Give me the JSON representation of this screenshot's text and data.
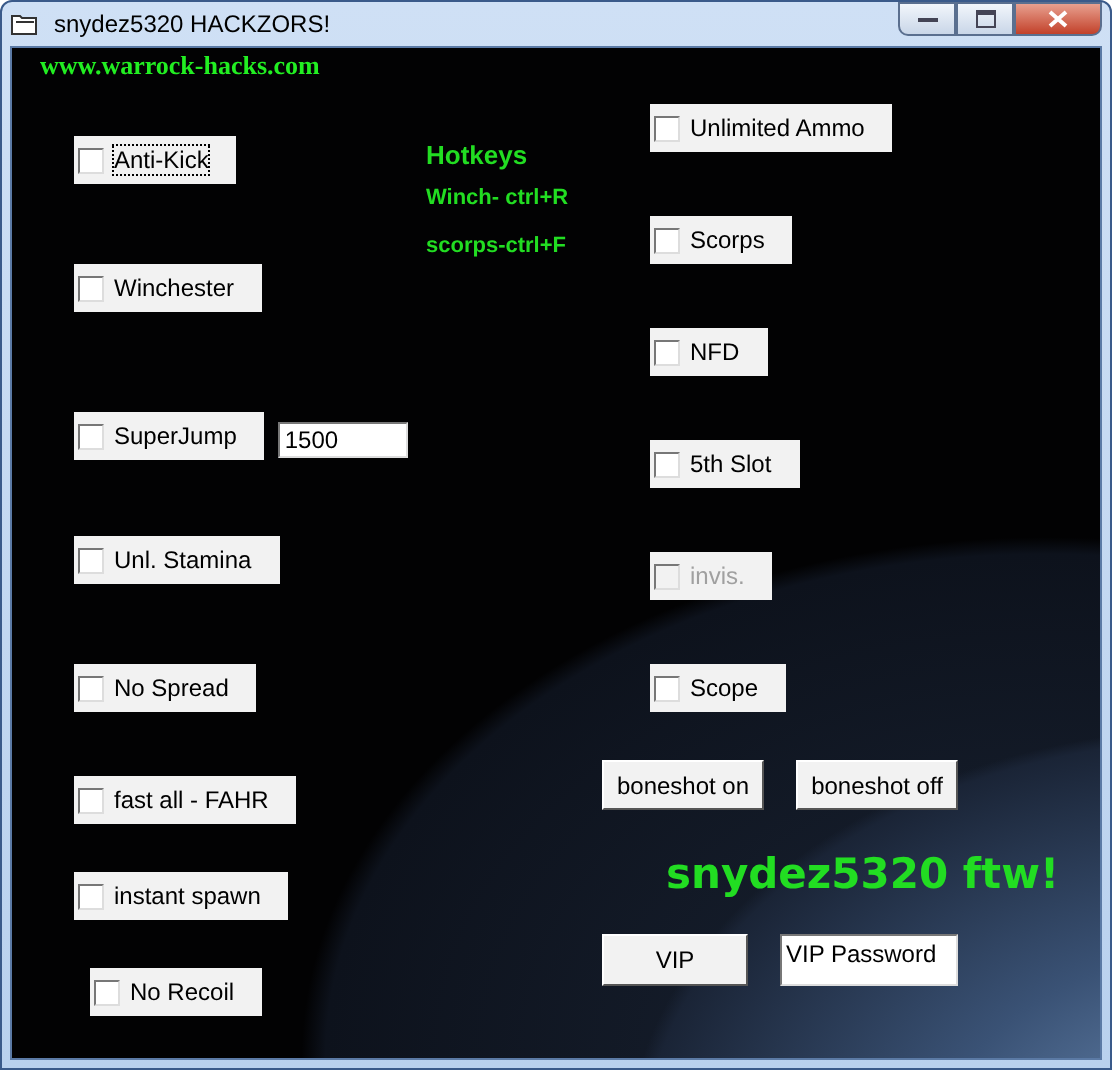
{
  "window": {
    "title": "snydez5320 HACKZORS!"
  },
  "site_link": "www.warrock-hacks.com",
  "hotkeys": {
    "title": "Hotkeys",
    "lines": [
      "Winch- ctrl+R",
      "scorps-ctrl+F"
    ]
  },
  "left_options": [
    {
      "label": "Anti-Kick",
      "checked": false,
      "focused": true,
      "disabled": false
    },
    {
      "label": "Winchester",
      "checked": false,
      "focused": false,
      "disabled": false
    },
    {
      "label": "SuperJump",
      "checked": false,
      "focused": false,
      "disabled": false,
      "field": "1500"
    },
    {
      "label": "Unl. Stamina",
      "checked": false,
      "focused": false,
      "disabled": false
    },
    {
      "label": "No Spread",
      "checked": false,
      "focused": false,
      "disabled": false
    },
    {
      "label": "fast all - FAHR",
      "checked": false,
      "focused": false,
      "disabled": false
    },
    {
      "label": "instant spawn",
      "checked": false,
      "focused": false,
      "disabled": false
    },
    {
      "label": "No Recoil",
      "checked": false,
      "focused": false,
      "disabled": false
    }
  ],
  "right_options": [
    {
      "label": "Unlimited Ammo",
      "checked": false,
      "focused": false,
      "disabled": false
    },
    {
      "label": "Scorps",
      "checked": false,
      "focused": false,
      "disabled": false
    },
    {
      "label": "NFD",
      "checked": false,
      "focused": false,
      "disabled": false
    },
    {
      "label": "5th Slot",
      "checked": false,
      "focused": false,
      "disabled": false
    },
    {
      "label": "invis.",
      "checked": false,
      "focused": false,
      "disabled": true
    },
    {
      "label": "Scope",
      "checked": false,
      "focused": false,
      "disabled": false
    }
  ],
  "boneshot_buttons": [
    "boneshot on",
    "boneshot off"
  ],
  "banner": "snydez5320 ftw!",
  "vip": {
    "button": "VIP",
    "password": "VIP Password"
  }
}
